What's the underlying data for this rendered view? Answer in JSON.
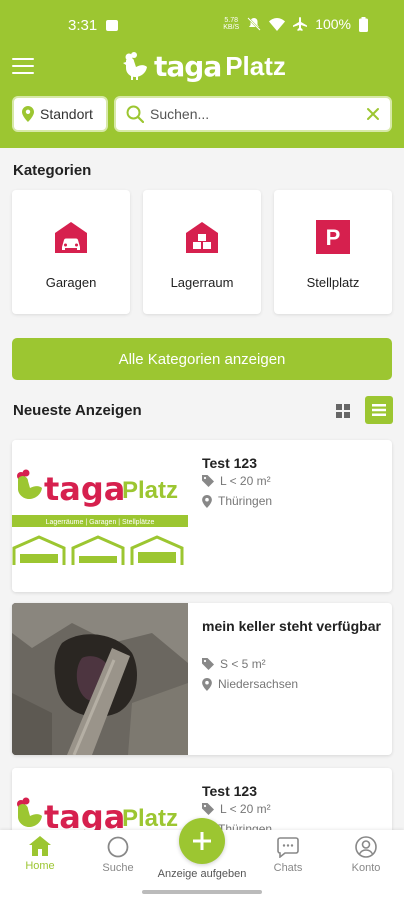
{
  "status": {
    "time": "3:31",
    "netspeed": "5.78\nKB/S",
    "battery": "100%"
  },
  "app": {
    "logo_taga": "taga",
    "logo_platz": "Platz"
  },
  "search": {
    "location_label": "Standort",
    "placeholder": "Suchen..."
  },
  "categories": {
    "title": "Kategorien",
    "items": [
      {
        "label": "Garagen",
        "icon": "garage-icon"
      },
      {
        "label": "Lagerraum",
        "icon": "storage-icon"
      },
      {
        "label": "Stellplatz",
        "icon": "parking-icon"
      }
    ],
    "all_button": "Alle Kategorien anzeigen"
  },
  "listings": {
    "title": "Neueste Anzeigen",
    "items": [
      {
        "title": "Test 123",
        "size": "L < 20 m²",
        "region": "Thüringen",
        "logo_taga": "taga",
        "logo_platz": "Platz",
        "logo_tagline": "Lagerräume | Garagen | Stellplätze"
      },
      {
        "title": "mein keller steht verfügbar",
        "size": "S < 5 m²",
        "region": "Niedersachsen"
      },
      {
        "title": "Test 123",
        "size": "L < 20 m²",
        "region": "Thüringen",
        "logo_taga": "taga",
        "logo_platz": "Platz"
      }
    ]
  },
  "nav": {
    "home": "Home",
    "search": "Suche",
    "post": "Anzeige aufgeben",
    "chats": "Chats",
    "account": "Konto"
  },
  "colors": {
    "brand": "#9cc631",
    "accent": "#d6204e"
  }
}
